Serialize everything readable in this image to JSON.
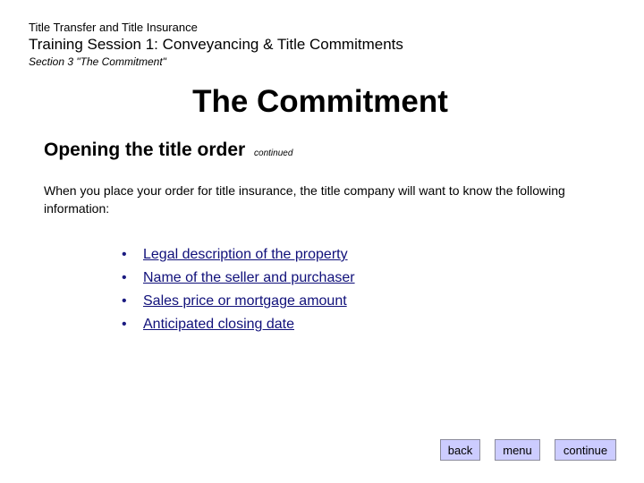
{
  "header": {
    "course_title": "Title Transfer and Title Insurance",
    "session_title": "Training Session 1: Conveyancing & Title Commitments",
    "section_title": "Section 3 \"The Commitment\""
  },
  "main": {
    "page_title": "The Commitment",
    "subheading": "Opening the title order",
    "subheading_note": "continued",
    "intro": "When you place your order for title insurance, the title company will want to know the following information:",
    "bullet_glyph": "•",
    "items": [
      {
        "label": "Legal description of the property"
      },
      {
        "label": "Name of the seller and purchaser"
      },
      {
        "label": "Sales price or mortgage amount"
      },
      {
        "label": "Anticipated closing date"
      }
    ]
  },
  "nav": {
    "back_label": "back",
    "menu_label": "menu",
    "continue_label": "continue"
  },
  "colors": {
    "link": "#10107a",
    "button_bg": "#ccccff",
    "button_border": "#8c8c9c"
  }
}
